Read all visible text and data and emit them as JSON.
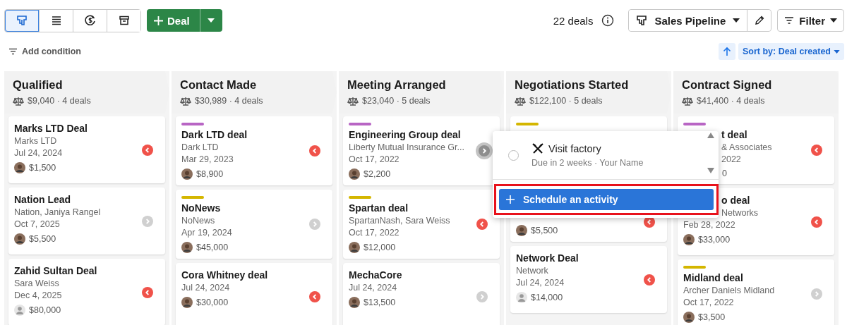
{
  "toolbar": {
    "views": [
      {
        "kind": "pipeline",
        "selected": true
      },
      {
        "kind": "list",
        "selected": false
      },
      {
        "kind": "forecast",
        "selected": false
      },
      {
        "kind": "archive",
        "selected": false
      }
    ],
    "add_button": {
      "label": "Deal"
    },
    "deal_count": "22 deals",
    "pipeline": {
      "label": "Sales Pipeline"
    },
    "filter": {
      "label": "Filter"
    }
  },
  "filter_bar": {
    "add_condition": "Add condition",
    "sort": "Sort by: Deal created"
  },
  "stages": [
    {
      "title": "Qualified",
      "summary": "$9,040 · 4 deals",
      "cards": [
        {
          "overdue": true,
          "hovered": false,
          "covered": false,
          "lines": [
            {
              "kind": "title",
              "text": "Marks LTD Deal"
            },
            {
              "kind": "subtitle",
              "text": "Marks LTD"
            },
            {
              "kind": "date",
              "text": "Jul 24, 2024"
            },
            {
              "kind": "amount_photo",
              "text": "$1,500"
            }
          ]
        },
        {
          "overdue": false,
          "hovered": false,
          "covered": false,
          "lines": [
            {
              "kind": "title",
              "text": "Nation Lead"
            },
            {
              "kind": "subtitle",
              "text": "Nation, Janiya Rangel"
            },
            {
              "kind": "date",
              "text": "Oct 7, 2025"
            },
            {
              "kind": "amount_photo",
              "text": "$5,500"
            }
          ]
        },
        {
          "overdue": true,
          "hovered": false,
          "covered": false,
          "lines": [
            {
              "kind": "title",
              "text": "Zahid Sultan Deal"
            },
            {
              "kind": "subtitle",
              "text": "Sara Weiss"
            },
            {
              "kind": "date",
              "text": "Dec 4, 2025"
            },
            {
              "kind": "amount_person",
              "text": "$80,000"
            }
          ]
        }
      ]
    },
    {
      "title": "Contact Made",
      "summary": "$30,989 · 4 deals",
      "cards": [
        {
          "color": "#b865c4",
          "overdue": true,
          "hovered": false,
          "covered": false,
          "lines": [
            {
              "kind": "title",
              "text": "Dark LTD deal"
            },
            {
              "kind": "subtitle",
              "text": "Dark LTD"
            },
            {
              "kind": "date",
              "text": "Mar 29, 2023"
            },
            {
              "kind": "amount_photo",
              "text": "$8,900"
            }
          ]
        },
        {
          "color": "#d4b600",
          "overdue": false,
          "hovered": false,
          "covered": false,
          "lines": [
            {
              "kind": "title",
              "text": "NoNews"
            },
            {
              "kind": "subtitle",
              "text": "NoNews"
            },
            {
              "kind": "date",
              "text": "Apr 19, 2024"
            },
            {
              "kind": "amount_photo",
              "text": "$45,000"
            }
          ]
        },
        {
          "overdue": true,
          "hovered": false,
          "covered": false,
          "lines": [
            {
              "kind": "title",
              "text": "Cora Whitney deal"
            },
            {
              "kind": "date",
              "text": "Jul 24, 2024"
            },
            {
              "kind": "amount_photo",
              "text": "$30,000"
            }
          ]
        }
      ]
    },
    {
      "title": "Meeting Arranged",
      "summary": "$23,040 · 5 deals",
      "cards": [
        {
          "color": "#b865c4",
          "overdue": false,
          "hovered": true,
          "covered": false,
          "lines": [
            {
              "kind": "title",
              "text": "Engineering Group deal"
            },
            {
              "kind": "subtitle",
              "text": "Liberty Mutual Insurance Gr..."
            },
            {
              "kind": "date",
              "text": "Oct 17, 2022"
            },
            {
              "kind": "amount_photo",
              "text": "$2,200"
            }
          ]
        },
        {
          "color": "#d4b600",
          "overdue": true,
          "hovered": false,
          "covered": false,
          "lines": [
            {
              "kind": "title",
              "text": "Spartan deal"
            },
            {
              "kind": "subtitle",
              "text": "SpartanNash, Sara Weiss"
            },
            {
              "kind": "date",
              "text": "Oct 17, 2022"
            },
            {
              "kind": "amount_photo",
              "text": "$12,000"
            }
          ]
        },
        {
          "overdue": false,
          "hovered": false,
          "covered": false,
          "lines": [
            {
              "kind": "title",
              "text": "MechaCore"
            },
            {
              "kind": "date",
              "text": "Jul 24, 2024"
            },
            {
              "kind": "amount_photo",
              "text": "$13,500"
            }
          ]
        }
      ]
    },
    {
      "title": "Negotiations Started",
      "summary": "$122,100 · 5 deals",
      "cards": [
        {
          "color": "#d4b600",
          "overdue": true,
          "hovered": false,
          "covered": true,
          "lines": [
            {
              "kind": "amount_photo",
              "text": "$5,500"
            }
          ]
        },
        {
          "overdue": true,
          "hovered": false,
          "covered": false,
          "lines": [
            {
              "kind": "title",
              "text": "Network Deal"
            },
            {
              "kind": "subtitle",
              "text": "Network"
            },
            {
              "kind": "date",
              "text": "Jul 24, 2024"
            },
            {
              "kind": "amount_person",
              "text": "$14,000"
            }
          ]
        }
      ]
    },
    {
      "title": "Contract Signed",
      "summary": "$41,400 · 4 deals",
      "cards": [
        {
          "color": "#b865c4",
          "overdue": true,
          "hovered": false,
          "covered": false,
          "lines": [
            {
              "kind": "title_cut",
              "text": "t deal"
            },
            {
              "kind": "subtitle_cut",
              "text": "& Associates"
            },
            {
              "kind": "date_cut",
              "text": "2022"
            },
            {
              "kind": "amount_cut",
              "text": "0"
            }
          ]
        },
        {
          "overdue": true,
          "hovered": false,
          "covered": false,
          "lines": [
            {
              "kind": "title_cut",
              "text": "o deal"
            },
            {
              "kind": "subtitle_cut",
              "text": "Networks"
            },
            {
              "kind": "date",
              "text": "Feb 28, 2022"
            },
            {
              "kind": "amount_photo",
              "text": "$33,000"
            }
          ]
        },
        {
          "color": "#d4b600",
          "overdue": false,
          "hovered": false,
          "covered": false,
          "lines": [
            {
              "kind": "title",
              "text": "Midland deal"
            },
            {
              "kind": "subtitle",
              "text": "Archer Daniels Midland"
            },
            {
              "kind": "date",
              "text": "Oct 17, 2022"
            },
            {
              "kind": "amount_photo",
              "text": "$3,500"
            }
          ]
        }
      ]
    }
  ],
  "activity_popup": {
    "activity": {
      "title": "Visit factory",
      "meta": "Due in 2 weeks · Your Name",
      "done": false
    },
    "schedule_button": "Schedule an activity",
    "highlighted": true
  }
}
